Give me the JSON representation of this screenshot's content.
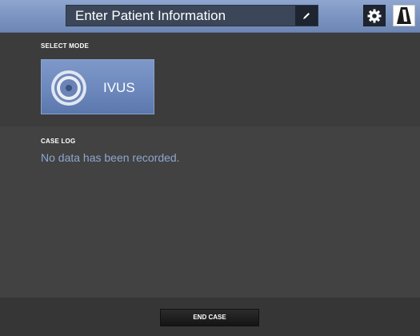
{
  "header": {
    "title": "Enter Patient Information",
    "edit_icon": "pencil-icon",
    "settings_icon": "gear-icon",
    "logo_icon": "brand-logo-icon"
  },
  "select_mode": {
    "label": "SELECT MODE",
    "modes": [
      {
        "label": "IVUS",
        "icon": "ivus-icon"
      }
    ]
  },
  "case_log": {
    "label": "CASE LOG",
    "empty_message": "No data has been recorded."
  },
  "footer": {
    "end_case_label": "END CASE"
  },
  "colors": {
    "accent": "#7a93c0",
    "background": "#3c3c3c",
    "empty_text": "#8ea6cf"
  }
}
